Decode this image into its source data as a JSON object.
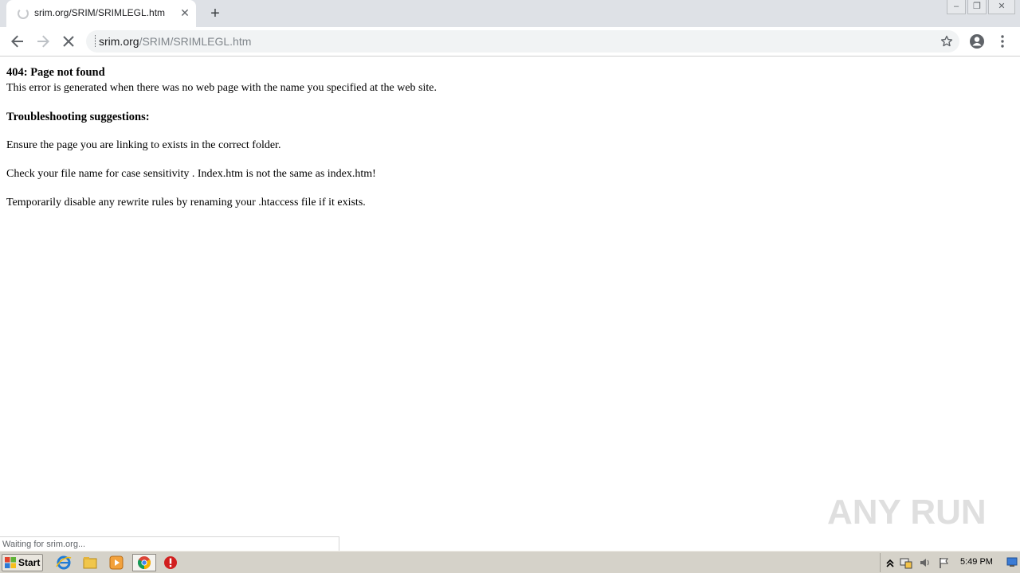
{
  "browser": {
    "tab": {
      "title": "srim.org/SRIM/SRIMLEGL.htm"
    },
    "address": {
      "host": "srim.org",
      "path": "/SRIM/SRIMLEGL.htm"
    },
    "status_text": "Waiting for srim.org..."
  },
  "page": {
    "heading": "404: Page not found",
    "intro": "This error is generated when there was no web page with the name you specified at the web site.",
    "subheading": "Troubleshooting suggestions:",
    "suggestions": [
      "Ensure the page you are linking to exists in the correct folder.",
      "Check your file name for case sensitivity . Index.htm is not the same as index.htm!",
      "Temporarily disable any rewrite rules by renaming your .htaccess file if it exists."
    ]
  },
  "watermark": {
    "text": "ANY RUN"
  },
  "taskbar": {
    "start_label": "Start",
    "clock": "5:49 PM"
  }
}
